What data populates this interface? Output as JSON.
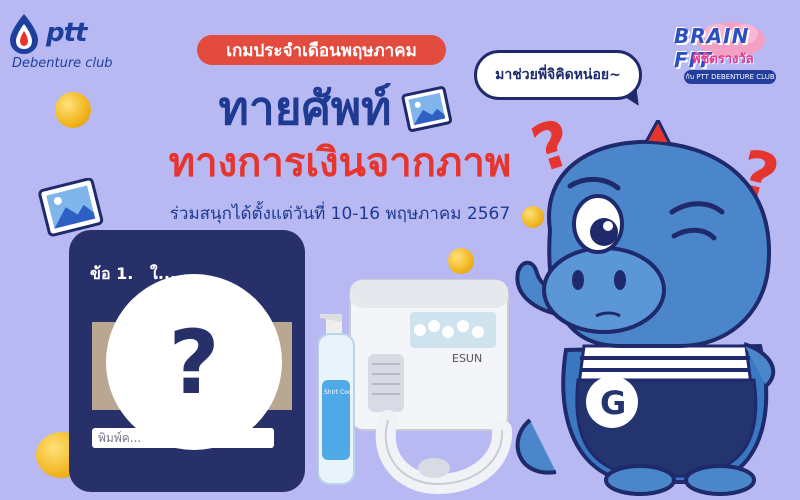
{
  "brand": {
    "logo_text": "ptt",
    "logo_subtitle": "Debenture club",
    "primary_color": "#1e3f9b",
    "accent_color": "#e6342f",
    "background_color": "#b8b9f3"
  },
  "header": {
    "month_label": "เกมประจำเดือนพฤษภาคม",
    "title_line1": "ทายศัพท์",
    "title_line2": "ทางการเงินจากภาพ",
    "dates": "ร่วมสนุกได้ตั้งแต่วันที่ 10-16 พฤษภาคม 2567"
  },
  "speech_bubble": "มาช่วยพี่จิคิดหน่อย~",
  "badge": {
    "line1": "BRAIN FIT",
    "line2": "พิชิตรางวัล",
    "line3": "กับ PTT DEBENTURE CLUB"
  },
  "quiz": {
    "question_number": "ข้อ 1.",
    "question_text": "ใ...",
    "mystery_mark": "?",
    "answer_placeholder": "พิมพ์ค..."
  },
  "decorations": {
    "question_mark": "?",
    "mascot_shirt_letter": "G",
    "icons": [
      "image-icon",
      "coin-icon",
      "question-mark-icon",
      "mascot-icon"
    ]
  },
  "prizes": {
    "ice_maker_brand": "ESUN",
    "spray_label": "Shirt Cool"
  }
}
